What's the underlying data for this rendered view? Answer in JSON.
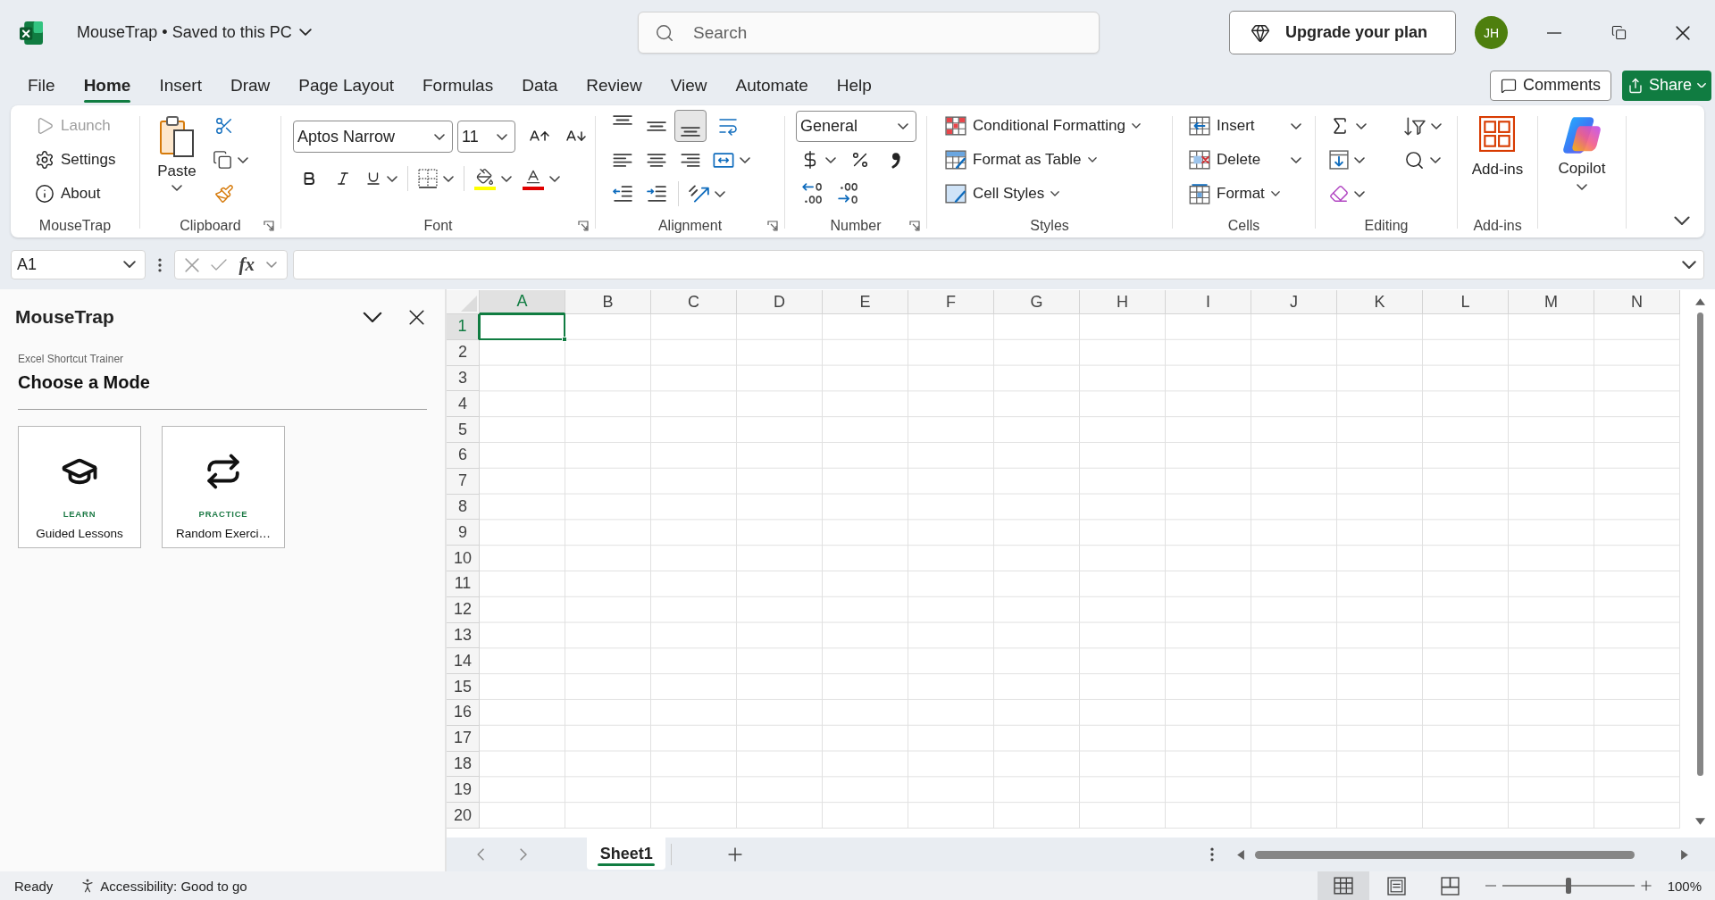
{
  "window": {
    "title": "MouseTrap • Saved to this PC"
  },
  "search": {
    "placeholder": "Search"
  },
  "upgrade_button": {
    "label": "Upgrade your plan"
  },
  "account": {
    "initials": "JH"
  },
  "ribbon_tabs": [
    {
      "label": "File",
      "selected": false
    },
    {
      "label": "Home",
      "selected": true
    },
    {
      "label": "Insert",
      "selected": false
    },
    {
      "label": "Draw",
      "selected": false
    },
    {
      "label": "Page Layout",
      "selected": false
    },
    {
      "label": "Formulas",
      "selected": false
    },
    {
      "label": "Data",
      "selected": false
    },
    {
      "label": "Review",
      "selected": false
    },
    {
      "label": "View",
      "selected": false
    },
    {
      "label": "Automate",
      "selected": false
    },
    {
      "label": "Help",
      "selected": false
    }
  ],
  "comments_button": {
    "label": "Comments"
  },
  "share_button": {
    "label": "Share"
  },
  "ribbon": {
    "mousetrap": {
      "label": "MouseTrap",
      "commands": [
        {
          "kind": "launch",
          "label": "Launch",
          "disabled": true
        },
        {
          "kind": "settings",
          "label": "Settings",
          "disabled": false
        },
        {
          "kind": "about",
          "label": "About",
          "disabled": false
        }
      ]
    },
    "clipboard": {
      "label": "Clipboard",
      "paste": "Paste"
    },
    "font": {
      "label": "Font",
      "font_name": "Aptos Narrow",
      "font_size": "11"
    },
    "alignment": {
      "label": "Alignment",
      "vertical": [
        {
          "kind": "top",
          "selected": false
        },
        {
          "kind": "middle",
          "selected": false
        },
        {
          "kind": "bottom",
          "selected": true
        }
      ]
    },
    "number": {
      "label": "Number",
      "format": "General"
    },
    "styles": {
      "label": "Styles",
      "commands": [
        {
          "kind": "conditional",
          "label": "Conditional Formatting"
        },
        {
          "kind": "table",
          "label": "Format as Table"
        },
        {
          "kind": "cell_styles",
          "label": "Cell Styles"
        }
      ]
    },
    "cells": {
      "label": "Cells",
      "commands": [
        {
          "kind": "insert",
          "label": "Insert"
        },
        {
          "kind": "delete",
          "label": "Delete"
        },
        {
          "kind": "format",
          "label": "Format"
        }
      ]
    },
    "editing": {
      "label": "Editing"
    },
    "addins": {
      "label": "Add-ins",
      "button": "Add-ins"
    },
    "copilot": {
      "button": "Copilot"
    }
  },
  "formula_bar": {
    "name_box": "A1",
    "function_button": "fx"
  },
  "task_pane": {
    "title": "MouseTrap",
    "subtitle": "Excel Shortcut Trainer",
    "heading": "Choose a Mode",
    "modes": [
      {
        "kind": "learn",
        "tag": "LEARN",
        "label": "Guided Lessons"
      },
      {
        "kind": "practice",
        "tag": "PRACTICE",
        "label": "Random Exerci…"
      }
    ]
  },
  "sheet": {
    "columns": [
      {
        "label": "A",
        "selected": true
      },
      {
        "label": "B",
        "selected": false
      },
      {
        "label": "C",
        "selected": false
      },
      {
        "label": "D",
        "selected": false
      },
      {
        "label": "E",
        "selected": false
      },
      {
        "label": "F",
        "selected": false
      },
      {
        "label": "G",
        "selected": false
      },
      {
        "label": "H",
        "selected": false
      },
      {
        "label": "I",
        "selected": false
      },
      {
        "label": "J",
        "selected": false
      },
      {
        "label": "K",
        "selected": false
      },
      {
        "label": "L",
        "selected": false
      },
      {
        "label": "M",
        "selected": false
      },
      {
        "label": "N",
        "selected": false
      }
    ],
    "rows": [
      {
        "label": "1",
        "selected": true
      },
      {
        "label": "2",
        "selected": false
      },
      {
        "label": "3",
        "selected": false
      },
      {
        "label": "4",
        "selected": false
      },
      {
        "label": "5",
        "selected": false
      },
      {
        "label": "6",
        "selected": false
      },
      {
        "label": "7",
        "selected": false
      },
      {
        "label": "8",
        "selected": false
      },
      {
        "label": "9",
        "selected": false
      },
      {
        "label": "10",
        "selected": false
      },
      {
        "label": "11",
        "selected": false
      },
      {
        "label": "12",
        "selected": false
      },
      {
        "label": "13",
        "selected": false
      },
      {
        "label": "14",
        "selected": false
      },
      {
        "label": "15",
        "selected": false
      },
      {
        "label": "16",
        "selected": false
      },
      {
        "label": "17",
        "selected": false
      },
      {
        "label": "18",
        "selected": false
      },
      {
        "label": "19",
        "selected": false
      },
      {
        "label": "20",
        "selected": false
      }
    ]
  },
  "sheet_tabs": [
    {
      "label": "Sheet1",
      "selected": true
    }
  ],
  "status_bar": {
    "mode": "Ready",
    "accessibility": "Accessibility: Good to go",
    "views": [
      {
        "kind": "normal",
        "selected": true
      },
      {
        "kind": "page_layout",
        "selected": false
      },
      {
        "kind": "page_break",
        "selected": false
      }
    ],
    "zoom": {
      "level": 0.5,
      "reading": "100%"
    }
  }
}
